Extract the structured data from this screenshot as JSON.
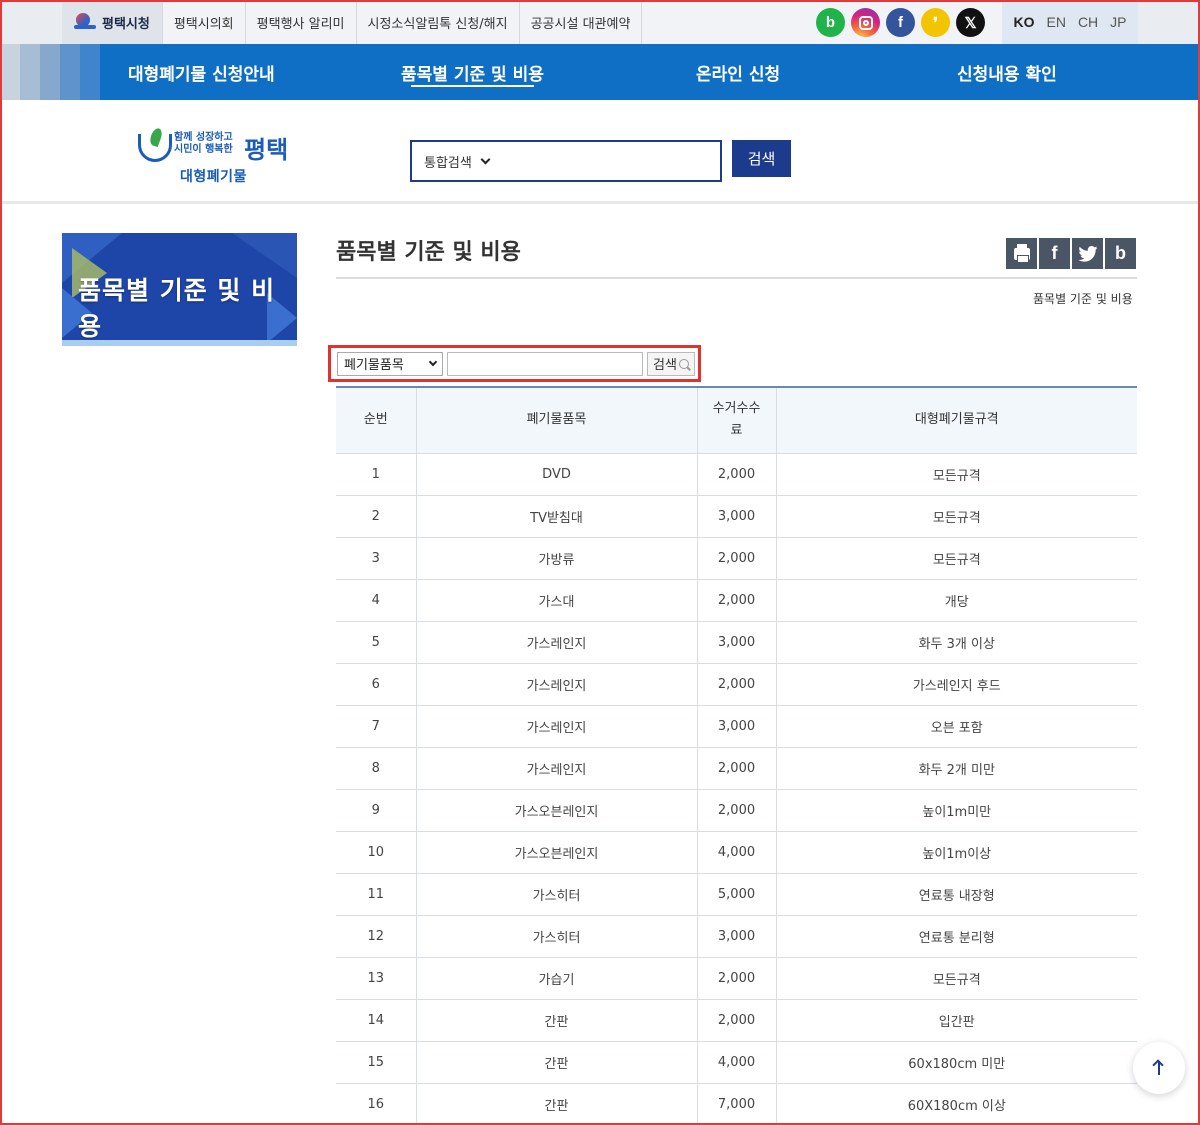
{
  "topbar": {
    "links": [
      "평택시청",
      "평택시의회",
      "평택행사 알리미",
      "시정소식알림톡 신청/해지",
      "공공시설 대관예약"
    ],
    "sns": [
      {
        "name": "blog-icon",
        "glyph": "b"
      },
      {
        "name": "instagram-icon",
        "glyph": ""
      },
      {
        "name": "facebook-icon",
        "glyph": "f"
      },
      {
        "name": "kakaostory-icon",
        "glyph": "❜"
      },
      {
        "name": "x-icon",
        "glyph": "𝕏"
      }
    ],
    "languages": [
      "KO",
      "EN",
      "CH",
      "JP"
    ],
    "active_language": "KO"
  },
  "nav": {
    "items": [
      "대형폐기물 신청안내",
      "품목별 기준 및 비용",
      "온라인 신청",
      "신청내용 확인"
    ],
    "active": 1
  },
  "header": {
    "logo_slogan_line1": "함께 성장하고",
    "logo_slogan_line2": "시민이 행복한",
    "logo_city": "평택",
    "logo_sub": "대형폐기물",
    "search_category": "통합검색",
    "search_button": "검색"
  },
  "side": {
    "banner_title": "품목별 기준 및 비용"
  },
  "content": {
    "title": "품목별 기준 및 비용",
    "breadcrumb": "품목별 기준 및 비용",
    "share_icons": [
      "print-icon",
      "facebook-icon",
      "twitter-icon",
      "blog-icon"
    ],
    "filter": {
      "select_value": "폐기물품목",
      "input_value": "",
      "button_label": "검색"
    }
  },
  "table": {
    "headers": [
      "순번",
      "폐기물품목",
      "수거수수\n료",
      "대형폐기물규격"
    ],
    "rows": [
      [
        "1",
        "DVD",
        "2,000",
        "모든규격"
      ],
      [
        "2",
        "TV받침대",
        "3,000",
        "모든규격"
      ],
      [
        "3",
        "가방류",
        "2,000",
        "모든규격"
      ],
      [
        "4",
        "가스대",
        "2,000",
        "개당"
      ],
      [
        "5",
        "가스레인지",
        "3,000",
        "화두 3개 이상"
      ],
      [
        "6",
        "가스레인지",
        "2,000",
        "가스레인지 후드"
      ],
      [
        "7",
        "가스레인지",
        "3,000",
        "오븐 포함"
      ],
      [
        "8",
        "가스레인지",
        "2,000",
        "화두 2개 미만"
      ],
      [
        "9",
        "가스오븐레인지",
        "2,000",
        "높이1m미만"
      ],
      [
        "10",
        "가스오븐레인지",
        "4,000",
        "높이1m이상"
      ],
      [
        "11",
        "가스히터",
        "5,000",
        "연료통 내장형"
      ],
      [
        "12",
        "가스히터",
        "3,000",
        "연료통 분리형"
      ],
      [
        "13",
        "가습기",
        "2,000",
        "모든규격"
      ],
      [
        "14",
        "간판",
        "2,000",
        "입간판"
      ],
      [
        "15",
        "간판",
        "4,000",
        "60x180cm 미만"
      ],
      [
        "16",
        "간판",
        "7,000",
        "60X180cm 이상"
      ]
    ]
  },
  "colors": {
    "nav_blue": "#0f6fc4",
    "navy": "#1c3b8c",
    "highlight_red": "#e0332f"
  }
}
